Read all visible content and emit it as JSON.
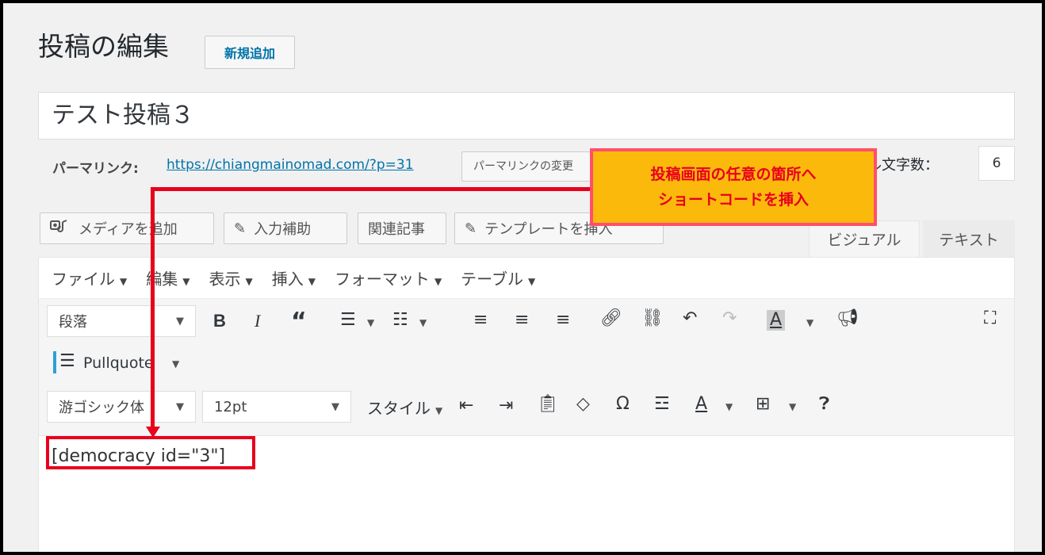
{
  "header": {
    "title": "投稿の編集",
    "add_new_label": "新規追加"
  },
  "post": {
    "title": "テスト投稿３"
  },
  "permalink": {
    "label": "パーマリンク:",
    "url": "https://chiangmainomad.com/?p=31",
    "change_button": "パーマリンクの変更"
  },
  "title_count": {
    "label": "ル文字数：",
    "value": "6"
  },
  "media_buttons": [
    {
      "label": "メディアを追加",
      "icon": "media-icon"
    },
    {
      "label": "入力補助",
      "icon": "pencil-icon"
    },
    {
      "label": "関連記事",
      "icon": ""
    },
    {
      "label": "テンプレートを挿入",
      "icon": "pencil-icon"
    }
  ],
  "tabs": {
    "visual": "ビジュアル",
    "text": "テキスト"
  },
  "menubar": [
    "ファイル",
    "編集",
    "表示",
    "挿入",
    "フォーマット",
    "テーブル"
  ],
  "toolbar": {
    "paragraph_format": "段落",
    "pullquote": "Pullquote",
    "font_family": "游ゴシック体",
    "font_size": "12pt",
    "style_label": "スタイル"
  },
  "content": {
    "text": "[democracy id=\"3\"]"
  },
  "callout": {
    "line1": "投稿画面の任意の箇所へ",
    "line2": "ショートコードを挿入"
  },
  "colors": {
    "annotation_red": "#e8001c",
    "callout_bg": "#fbb90c",
    "link_blue": "#0073aa"
  }
}
